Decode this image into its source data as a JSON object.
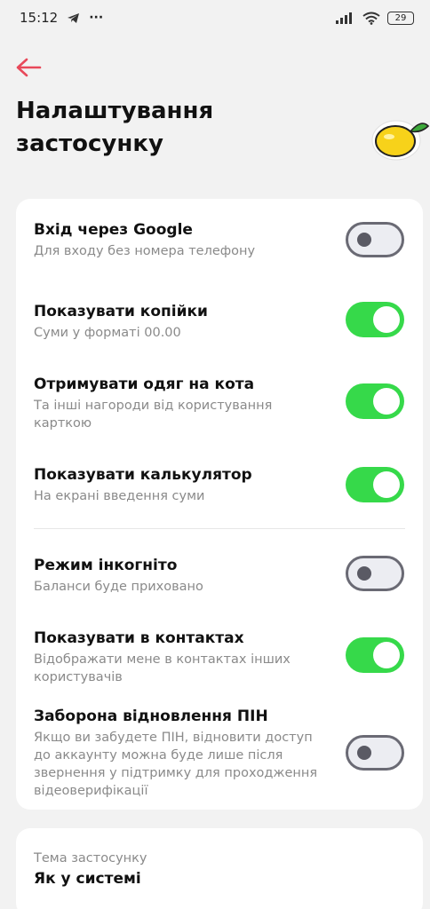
{
  "status_bar": {
    "time": "15:12",
    "more": "···",
    "battery": "29"
  },
  "page": {
    "title": "Налаштування застосунку"
  },
  "colors": {
    "accent_back": "#e8495a",
    "toggle_on": "#36d94a",
    "toggle_off": "#ecedf2"
  },
  "settings": [
    {
      "title": "Вхід через Google",
      "subtitle": "Для входу без номера телефону",
      "enabled": false
    },
    {
      "title": "Показувати копійки",
      "subtitle": "Суми у форматі 00.00",
      "enabled": true
    },
    {
      "title": "Отримувати одяг на кота",
      "subtitle": "Та інші нагороди від користування карткою",
      "enabled": true
    },
    {
      "title": "Показувати калькулятор",
      "subtitle": "На екрані введення суми",
      "enabled": true
    },
    {
      "title": "Режим інкогніто",
      "subtitle": "Баланси буде приховано",
      "enabled": false
    },
    {
      "title": "Показувати в контактах",
      "subtitle": "Відображати мене в контактах інших користувачів",
      "enabled": true
    },
    {
      "title": "Заборона відновлення ПІН",
      "subtitle": "Якщо ви забудете ПІН, відновити доступ до аккаунту можна буде лише після звернення у підтримку для проходження відеоверифікації",
      "enabled": false
    }
  ],
  "theme": {
    "label": "Тема застосунку",
    "value": "Як у системі"
  },
  "icons": {
    "back": "arrow-left-icon",
    "lemon": "lemon-icon",
    "telegram": "telegram-icon",
    "signal": "signal-icon",
    "wifi": "wifi-icon"
  }
}
